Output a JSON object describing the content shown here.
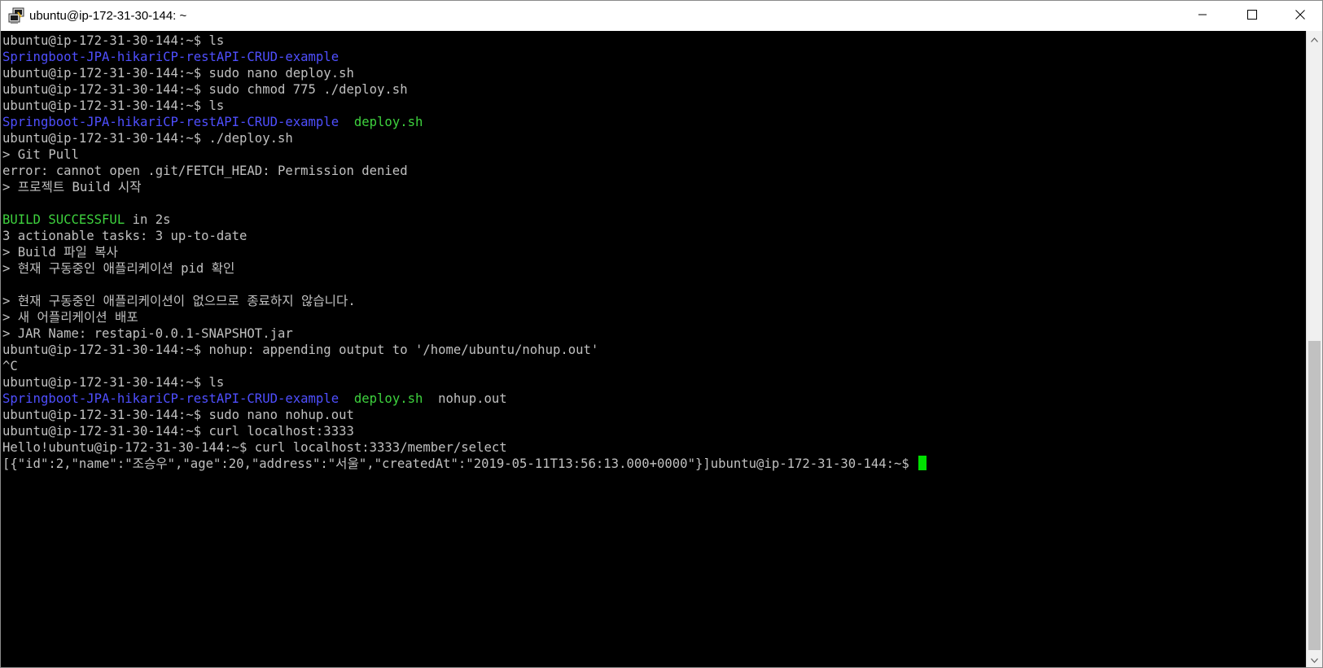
{
  "window": {
    "title": "ubuntu@ip-172-31-30-144: ~",
    "icon": "putty-terminal-icon"
  },
  "colors": {
    "background": "#000000",
    "text": "#c0c0c0",
    "directory": "#4f4fff",
    "executable": "#3ed23e",
    "cursor": "#00e000"
  },
  "terminal": {
    "lines": [
      [
        {
          "text": "ubuntu@ip-172-31-30-144:~$ ls",
          "color": "default"
        }
      ],
      [
        {
          "text": "Springboot-JPA-hikariCP-restAPI-CRUD-example",
          "color": "directory"
        }
      ],
      [
        {
          "text": "ubuntu@ip-172-31-30-144:~$ sudo nano deploy.sh",
          "color": "default"
        }
      ],
      [
        {
          "text": "ubuntu@ip-172-31-30-144:~$ sudo chmod 775 ./deploy.sh",
          "color": "default"
        }
      ],
      [
        {
          "text": "ubuntu@ip-172-31-30-144:~$ ls",
          "color": "default"
        }
      ],
      [
        {
          "text": "Springboot-JPA-hikariCP-restAPI-CRUD-example",
          "color": "directory"
        },
        {
          "text": "  ",
          "color": "default"
        },
        {
          "text": "deploy.sh",
          "color": "executable"
        }
      ],
      [
        {
          "text": "ubuntu@ip-172-31-30-144:~$ ./deploy.sh",
          "color": "default"
        }
      ],
      [
        {
          "text": "> Git Pull",
          "color": "default"
        }
      ],
      [
        {
          "text": "error: cannot open .git/FETCH_HEAD: Permission denied",
          "color": "default"
        }
      ],
      [
        {
          "text": "> 프로젝트 Build 시작",
          "color": "default"
        }
      ],
      [
        {
          "text": "",
          "color": "default"
        }
      ],
      [
        {
          "text": "BUILD SUCCESSFUL",
          "color": "executable"
        },
        {
          "text": " in 2s",
          "color": "default"
        }
      ],
      [
        {
          "text": "3 actionable tasks: 3 up-to-date",
          "color": "default"
        }
      ],
      [
        {
          "text": "> Build 파일 복사",
          "color": "default"
        }
      ],
      [
        {
          "text": "> 현재 구동중인 애플리케이션 pid 확인",
          "color": "default"
        }
      ],
      [
        {
          "text": "",
          "color": "default"
        }
      ],
      [
        {
          "text": "> 현재 구동중인 애플리케이션이 없으므로 종료하지 않습니다.",
          "color": "default"
        }
      ],
      [
        {
          "text": "> 새 어플리케이션 배포",
          "color": "default"
        }
      ],
      [
        {
          "text": "> JAR Name: restapi-0.0.1-SNAPSHOT.jar",
          "color": "default"
        }
      ],
      [
        {
          "text": "ubuntu@ip-172-31-30-144:~$ nohup: appending output to '/home/ubuntu/nohup.out'",
          "color": "default"
        }
      ],
      [
        {
          "text": "^C",
          "color": "default"
        }
      ],
      [
        {
          "text": "ubuntu@ip-172-31-30-144:~$ ls",
          "color": "default"
        }
      ],
      [
        {
          "text": "Springboot-JPA-hikariCP-restAPI-CRUD-example",
          "color": "directory"
        },
        {
          "text": "  ",
          "color": "default"
        },
        {
          "text": "deploy.sh",
          "color": "executable"
        },
        {
          "text": "  nohup.out",
          "color": "default"
        }
      ],
      [
        {
          "text": "ubuntu@ip-172-31-30-144:~$ sudo nano nohup.out",
          "color": "default"
        }
      ],
      [
        {
          "text": "ubuntu@ip-172-31-30-144:~$ curl localhost:3333",
          "color": "default"
        }
      ],
      [
        {
          "text": "Hello!ubuntu@ip-172-31-30-144:~$ curl localhost:3333/member/select",
          "color": "default"
        }
      ],
      [
        {
          "text": "[{\"id\":2,\"name\":\"조승우\",\"age\":20,\"address\":\"서울\",\"createdAt\":\"2019-05-11T13:56:13.000+0000\"}]ubuntu@ip-172-31-30-144:~$ ",
          "color": "default"
        }
      ]
    ],
    "cursor_line": 26
  },
  "controls": {
    "minimize_icon": "minimize-icon",
    "maximize_icon": "maximize-icon",
    "close_icon": "close-icon"
  }
}
